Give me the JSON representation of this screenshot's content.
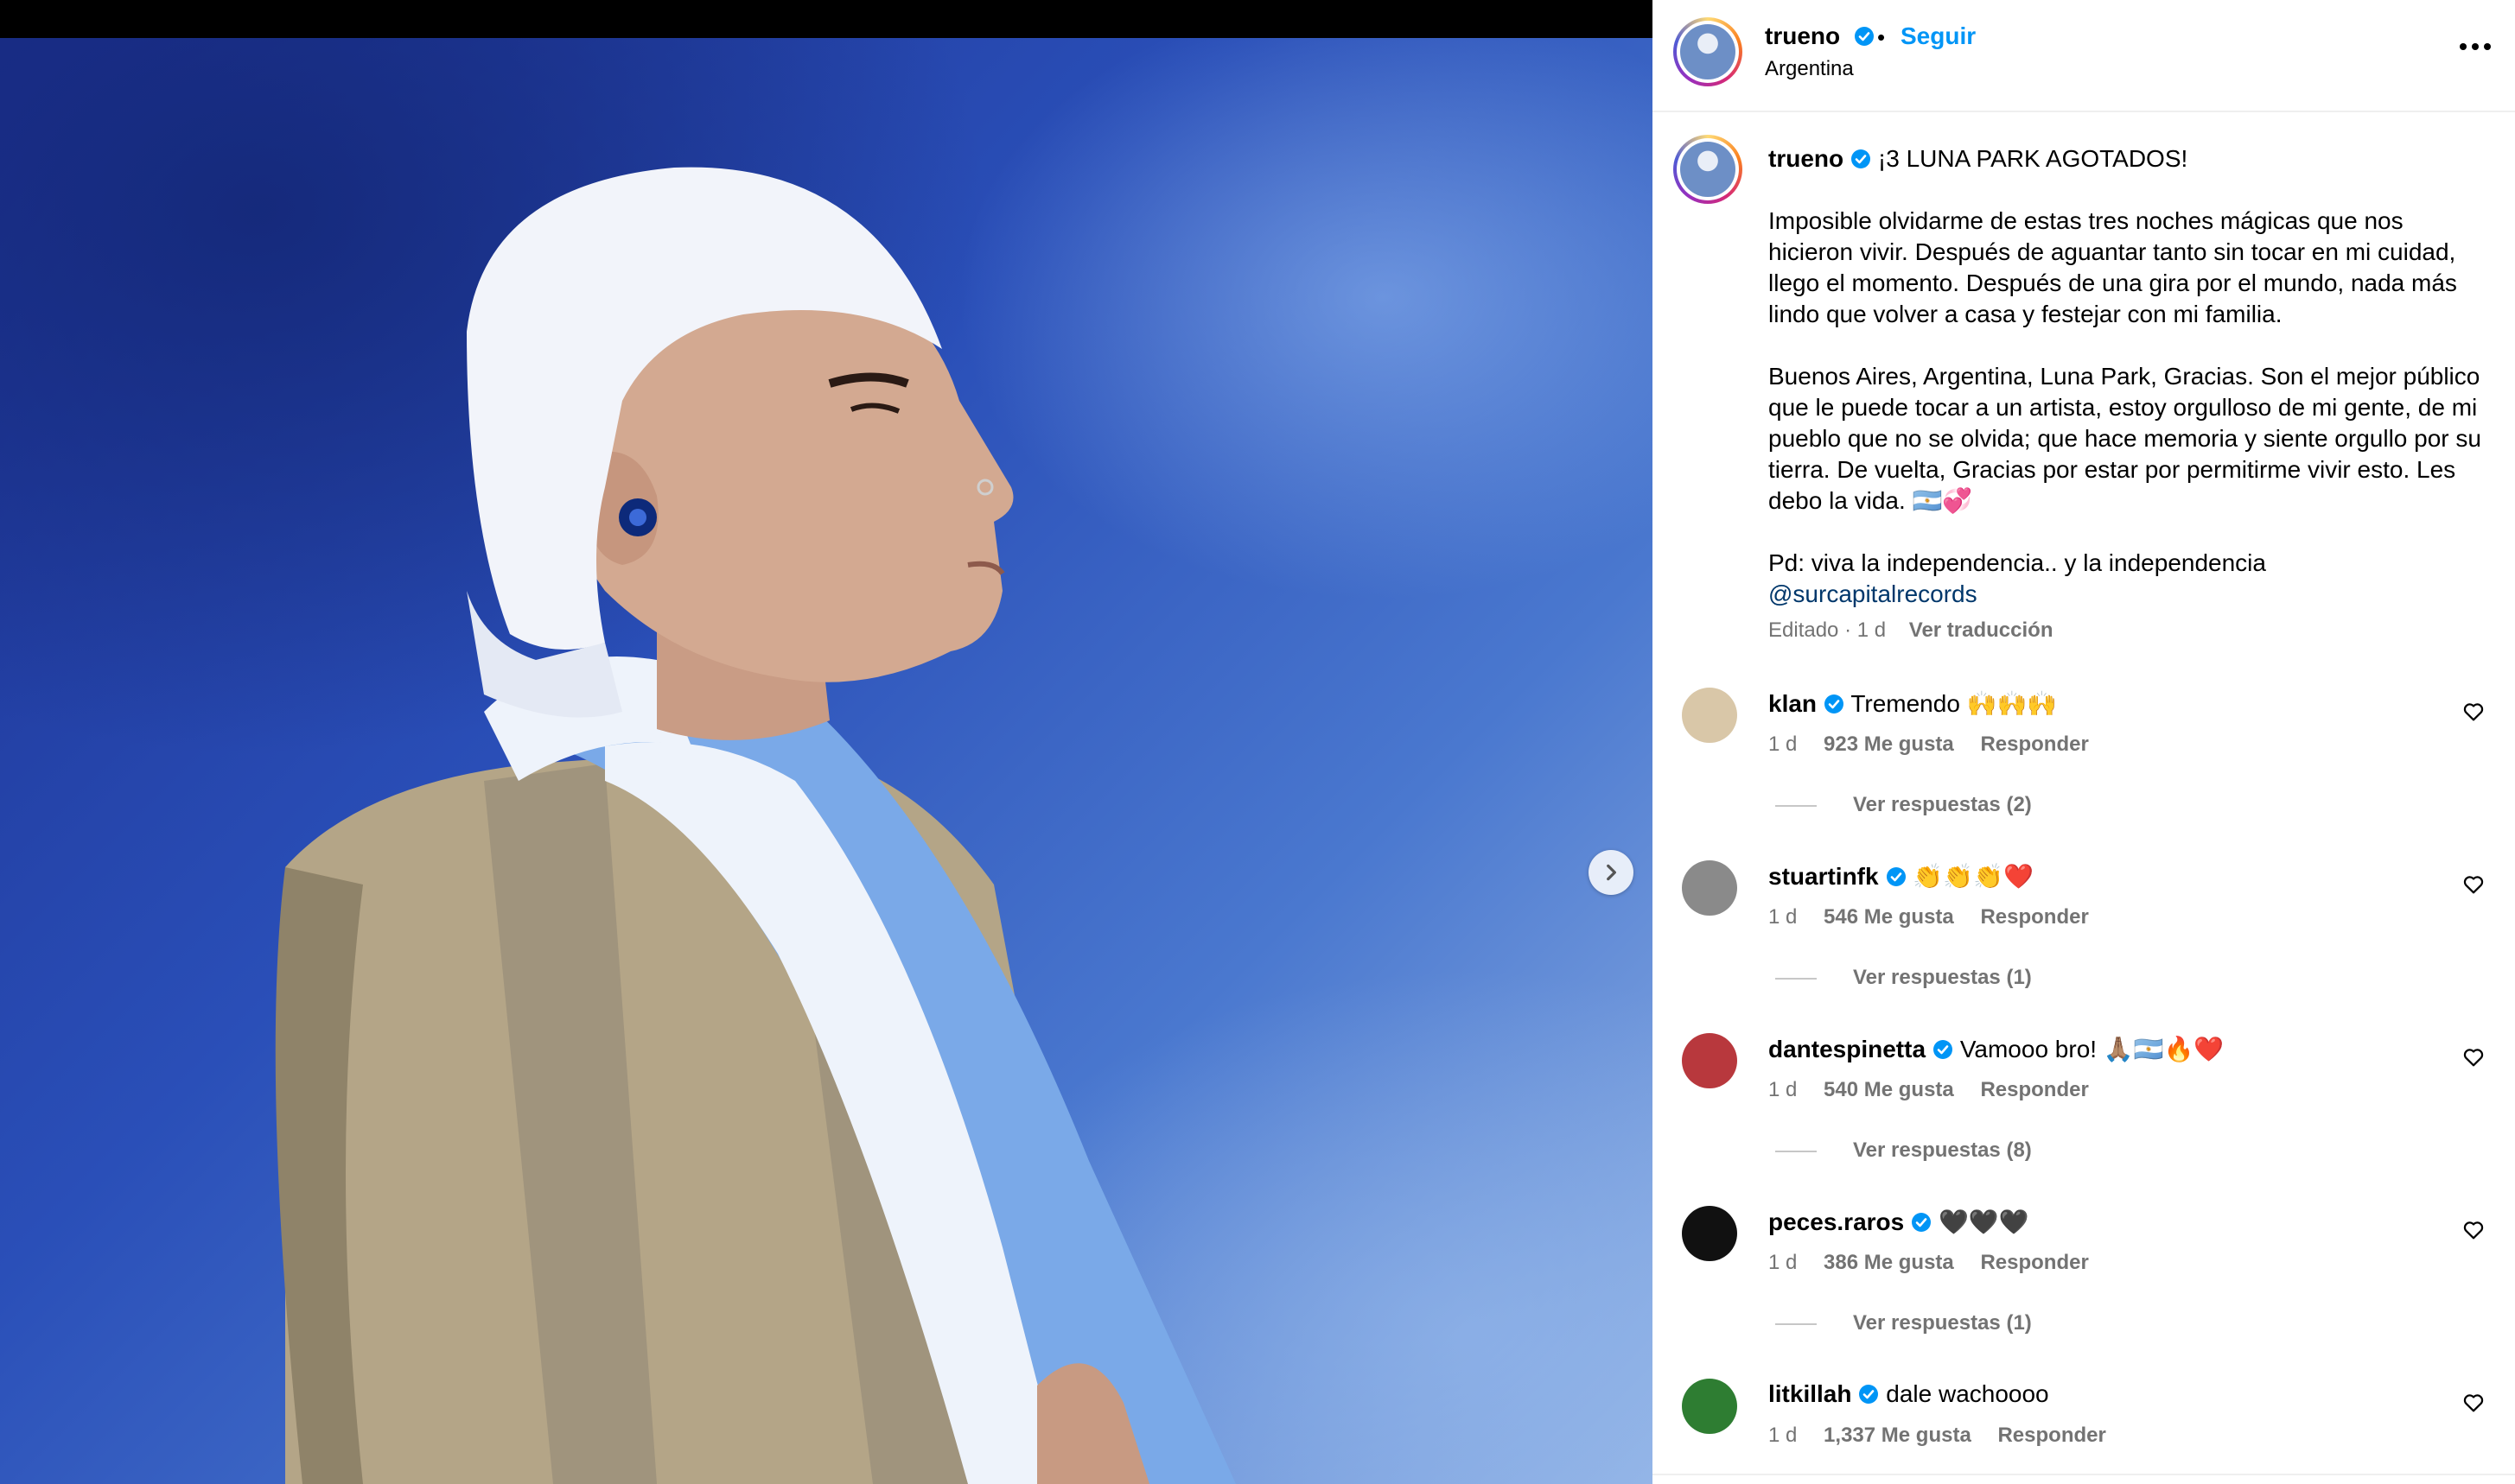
{
  "post": {
    "username": "trueno",
    "follow_label": "Seguir",
    "separator": "•",
    "location": "Argentina",
    "more_icon": "more-horizontal-icon"
  },
  "caption": {
    "username": "trueno",
    "headline": "¡3 LUNA PARK AGOTADOS!",
    "paragraph1": "Imposible olvidarme de estas tres noches mágicas que nos hicieron vivir. Después de aguantar tanto sin tocar en mi cuidad, llego el momento. Después de una gira por el mundo, nada más lindo que volver a casa y festejar con mi familia.",
    "paragraph2": "Buenos Aires, Argentina, Luna Park, Gracias. Son el mejor público que le puede tocar a un artista, estoy orgulloso de mi gente, de mi pueblo que no se olvida; que hace memoria y siente orgullo por su tierra. De vuelta, Gracias por estar por permitirme vivir esto. Les debo la vida. 🇦🇷💞",
    "paragraph3": "Pd: viva la independencia.. y la independencia",
    "mention": "@surcapitalrecords",
    "edited": "Editado · 1 d",
    "translate": "Ver traducción"
  },
  "comments": [
    {
      "username": "klan",
      "text": "Tremendo 🙌🙌🙌",
      "time": "1 d",
      "likes": "923 Me gusta",
      "reply": "Responder",
      "replies": "Ver respuestas (2)",
      "avatar_color": "#d9c7a8"
    },
    {
      "username": "stuartinfk",
      "text": "👏👏👏❤️",
      "time": "1 d",
      "likes": "546 Me gusta",
      "reply": "Responder",
      "replies": "Ver respuestas (1)",
      "avatar_color": "#8a8a8a"
    },
    {
      "username": "dantespinetta",
      "text": "Vamooo bro! 🙏🏽🇦🇷🔥❤️",
      "time": "1 d",
      "likes": "540 Me gusta",
      "reply": "Responder",
      "replies": "Ver respuestas (8)",
      "avatar_color": "#b8383d"
    },
    {
      "username": "peces.raros",
      "text": "🖤🖤🖤",
      "time": "1 d",
      "likes": "386 Me gusta",
      "reply": "Responder",
      "replies": "Ver respuestas (1)",
      "avatar_color": "#111111"
    },
    {
      "username": "litkillah",
      "text": "dale wachoooo",
      "time": "1 d",
      "likes": "1,337 Me gusta",
      "reply": "Responder",
      "replies": "",
      "avatar_color": "#2e7d32"
    }
  ],
  "colors": {
    "accent": "#0095f6",
    "verified": "#0095f6",
    "mention": "#00376b",
    "muted": "#737373"
  }
}
